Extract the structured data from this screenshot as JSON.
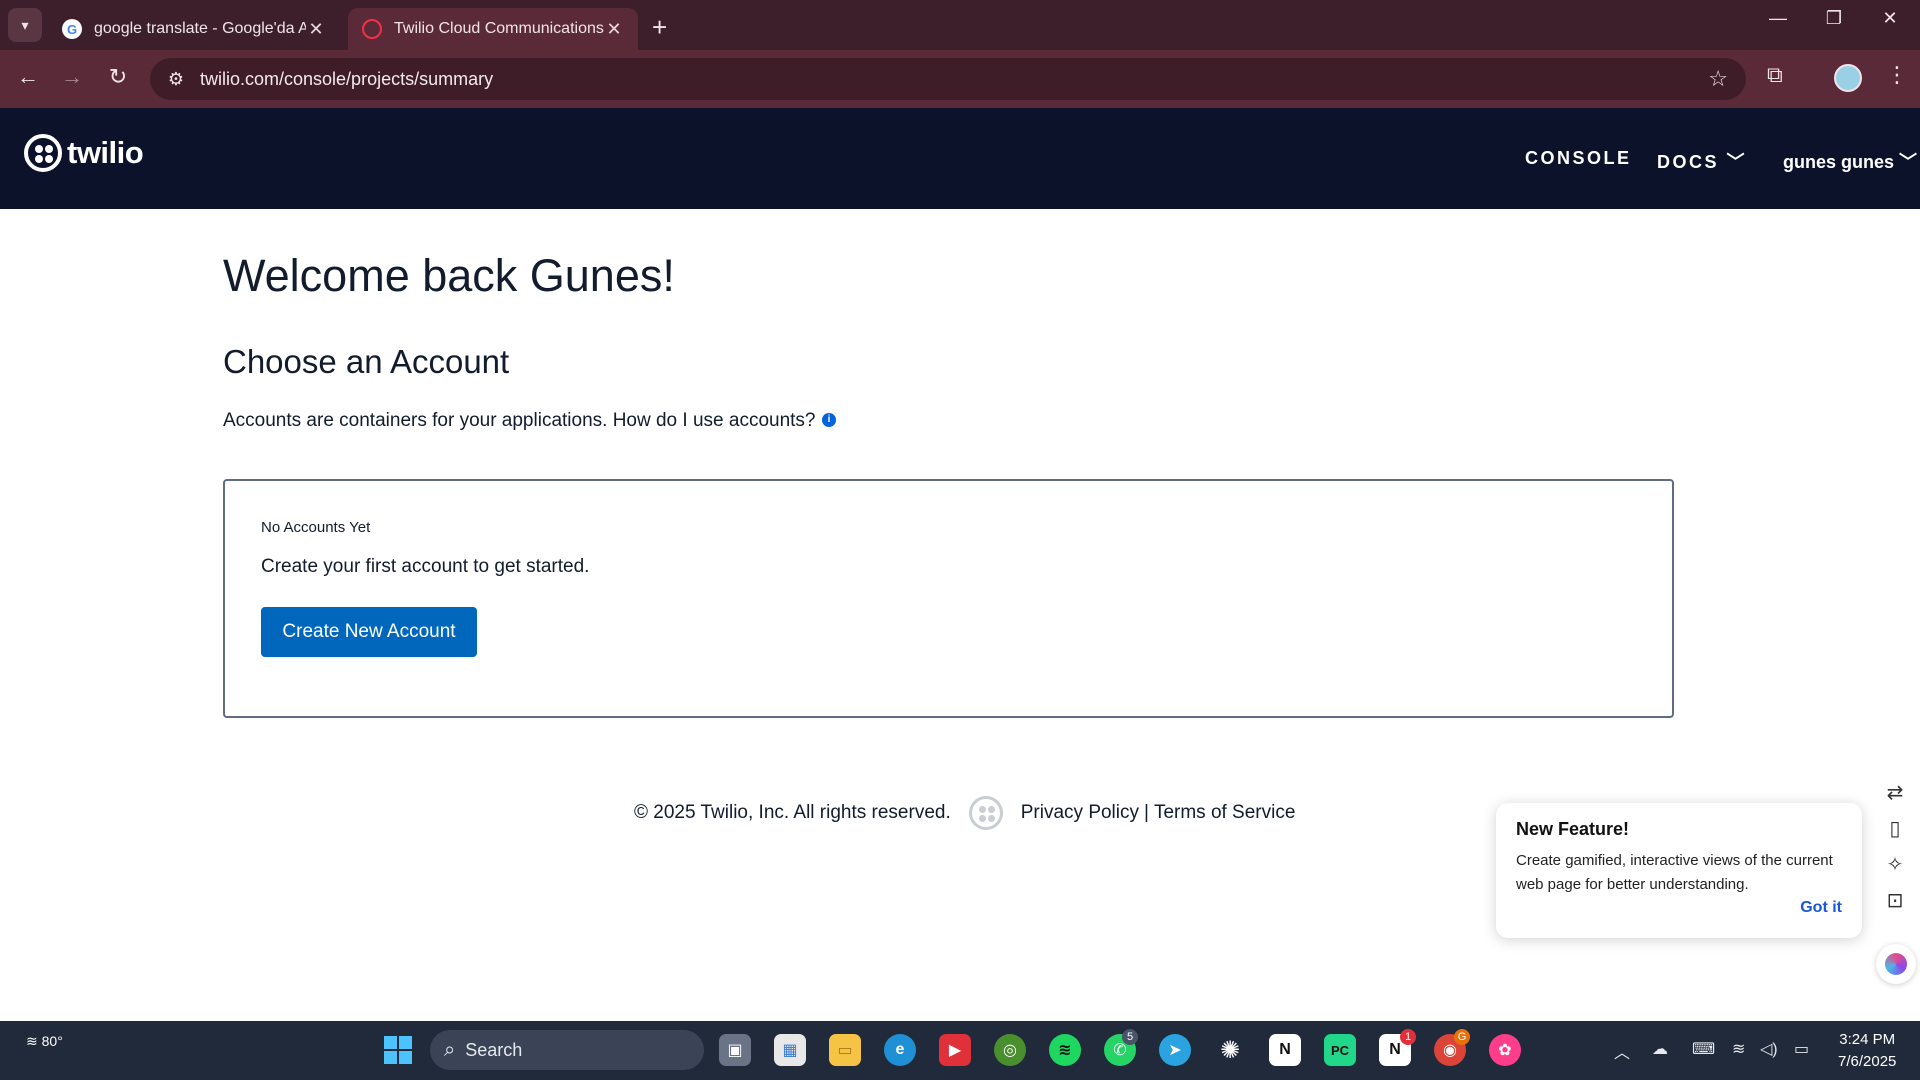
{
  "browser": {
    "tabs": [
      {
        "title": "google translate - Google'da Ar",
        "active": false
      },
      {
        "title": "Twilio Cloud Communications |",
        "active": true
      }
    ],
    "url": "twilio.com/console/projects/summary"
  },
  "header": {
    "logo_text": "twilio",
    "nav": {
      "console": "CONSOLE",
      "docs": "DOCS",
      "user": "gunes gunes"
    }
  },
  "main": {
    "welcome": "Welcome back Gunes!",
    "choose_heading": "Choose an Account",
    "description": "Accounts are containers for your applications. How do I use accounts?",
    "accounts_box": {
      "empty_label": "No Accounts Yet",
      "prompt": "Create your first account to get started.",
      "create_button": "Create New Account"
    }
  },
  "footer": {
    "copyright": "© 2025 Twilio, Inc. All rights reserved.",
    "privacy": "Privacy Policy",
    "separator": "|",
    "terms": "Terms of Service"
  },
  "popup": {
    "title": "New Feature!",
    "body": "Create gamified, interactive views of the current web page for better understanding.",
    "action": "Got it"
  },
  "taskbar": {
    "weather": "80°",
    "search_placeholder": "Search",
    "badges": {
      "whatsapp": "5",
      "notion": "1",
      "chrome": "G"
    },
    "time": "3:24 PM",
    "date": "7/6/2025"
  },
  "colors": {
    "site_header_bg": "#0d122b",
    "primary_button": "#0067bd",
    "browser_frame": "#5b2a38"
  }
}
